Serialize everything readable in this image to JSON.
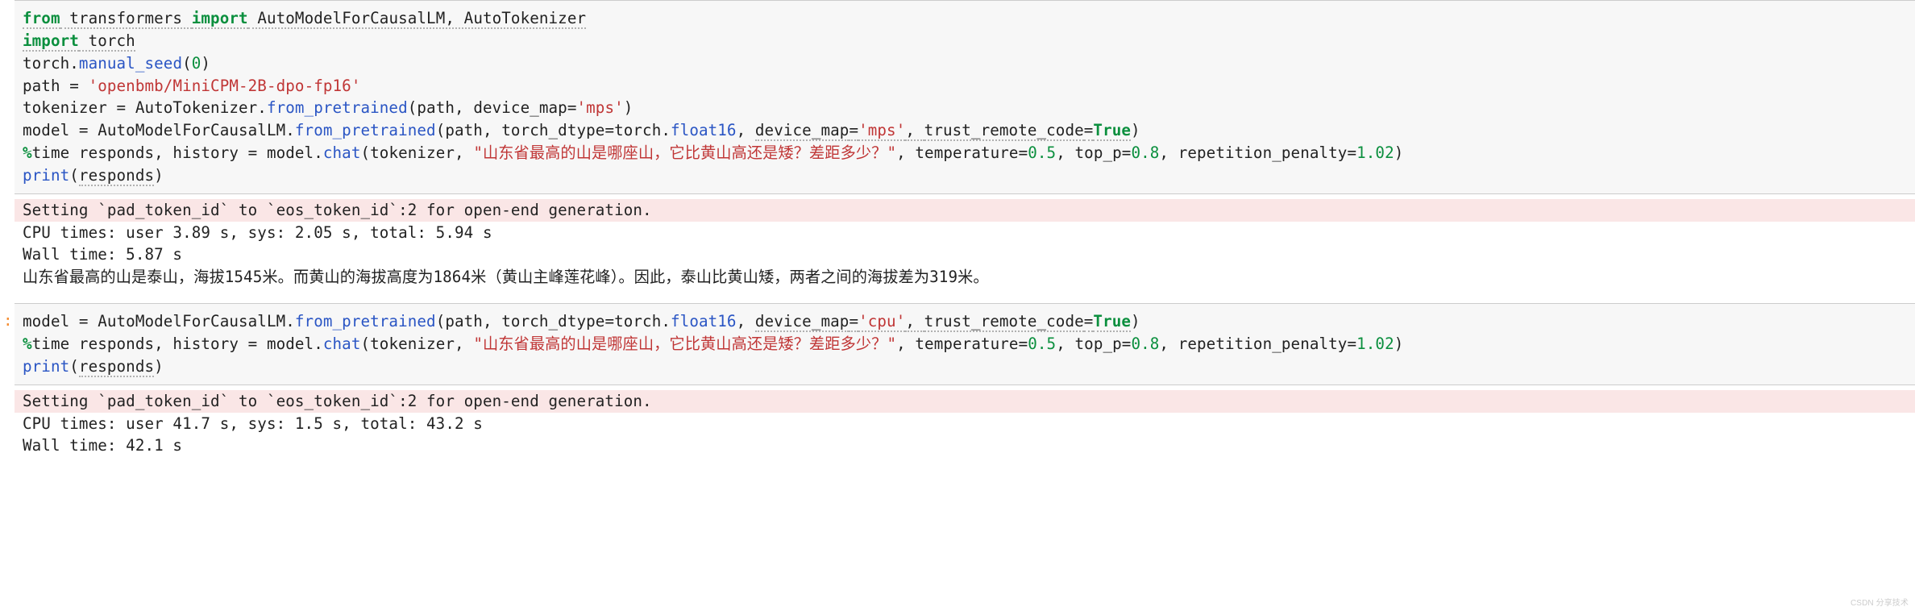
{
  "cell1": {
    "line1": {
      "from": "from",
      "mod": " transformers ",
      "imp": "import",
      "items": " AutoModelForCausalLM, AutoTokenizer"
    },
    "line2": {
      "imp": "import",
      "mod": " torch"
    },
    "line3": {
      "pre": "torch.",
      "fn": "manual_seed",
      "post": "(",
      "num": "0",
      "close": ")"
    },
    "line4": {
      "pre": "path = ",
      "str": "'openbmb/MiniCPM-2B-dpo-fp16'"
    },
    "line5": {
      "pre": "tokenizer = AutoTokenizer.",
      "fn": "from_pretrained",
      "open": "(path, ",
      "arg1": "device_map",
      "eq1": "=",
      "str1": "'mps'",
      "close": ")"
    },
    "line6": {
      "pre": "model = AutoModelForCausalLM.",
      "fn": "from_pretrained",
      "open": "(path, ",
      "arg1": "torch_dtype",
      "eq1": "=torch.",
      "sub1": "float16",
      "sep1": ", ",
      "arg2": "device_map",
      "eq2": "=",
      "str2": "'mps'",
      "sep2": ", ",
      "arg3": "trust_remote_code",
      "eq3": "=",
      "bool3": "True",
      "close": ")"
    },
    "line7": {
      "magic": "%",
      "cmd": "time responds, history = model.",
      "fn": "chat",
      "open": "(tokenizer, ",
      "str1": "\"山东省最高的山是哪座山，它比黄山高还是矮？差距多少？\"",
      "sep1": ", ",
      "arg1": "temperature",
      "eq1": "=",
      "num1": "0.5",
      "sep2": ", ",
      "arg2": "top_p",
      "eq2": "=",
      "num2": "0.8",
      "sep3": ", ",
      "arg3": "repetition_penalty",
      "eq3": "=",
      "num3": "1.02",
      "close": ")"
    },
    "line8": {
      "fn": "print",
      "open": "(",
      "arg": "responds",
      "close": ")"
    }
  },
  "out1": {
    "err": "Setting `pad_token_id` to `eos_token_id`:2 for open-end generation.",
    "cpu": "CPU times: user 3.89 s, sys: 2.05 s, total: 5.94 s",
    "wall": "Wall time: 5.87 s",
    "resp": "山东省最高的山是泰山，海拔1545米。而黄山的海拔高度为1864米（黄山主峰莲花峰）。因此，泰山比黄山矮，两者之间的海拔差为319米。"
  },
  "cell2": {
    "prompt": ":",
    "line1": {
      "pre": "model = AutoModelForCausalLM.",
      "fn": "from_pretrained",
      "open": "(path, ",
      "arg1": "torch_dtype",
      "eq1": "=torch.",
      "sub1": "float16",
      "sep1": ", ",
      "arg2": "device_map",
      "eq2": "=",
      "str2": "'cpu'",
      "sep2": ", ",
      "arg3": "trust_remote_code",
      "eq3": "=",
      "bool3": "True",
      "close": ")"
    },
    "line2": {
      "magic": "%",
      "cmd": "time responds, history = model.",
      "fn": "chat",
      "open": "(tokenizer, ",
      "str1": "\"山东省最高的山是哪座山，它比黄山高还是矮？差距多少？\"",
      "sep1": ", ",
      "arg1": "temperature",
      "eq1": "=",
      "num1": "0.5",
      "sep2": ", ",
      "arg2": "top_p",
      "eq2": "=",
      "num2": "0.8",
      "sep3": ", ",
      "arg3": "repetition_penalty",
      "eq3": "=",
      "num3": "1.02",
      "close": ")"
    },
    "line3": {
      "fn": "print",
      "open": "(",
      "arg": "responds",
      "close": ")"
    }
  },
  "out2": {
    "err": "Setting `pad_token_id` to `eos_token_id`:2 for open-end generation.",
    "cpu": "CPU times: user 41.7 s, sys: 1.5 s, total: 43.2 s",
    "wall": "Wall time: 42.1 s"
  },
  "watermark": "CSDN 分享技术"
}
